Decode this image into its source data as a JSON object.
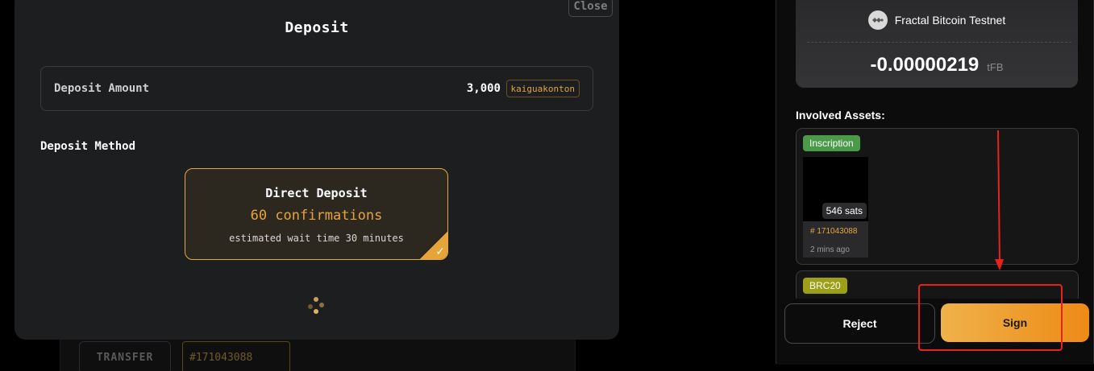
{
  "background": {
    "transfer_label": "TRANSFER",
    "inscription_label": "#171043088"
  },
  "modal": {
    "close_label": "Close",
    "title": "Deposit",
    "amount_label": "Deposit Amount",
    "amount_value": "3,000",
    "ticker": "kaiguakonton",
    "method_label": "Deposit Method",
    "method": {
      "title": "Direct Deposit",
      "confirmations": "60 confirmations",
      "wait": "estimated wait time 30 minutes",
      "selected": true
    }
  },
  "wallet": {
    "network_name": "Fractal Bitcoin Testnet",
    "network_icon": "fractal-logo-icon",
    "balance_change": "-0.00000219",
    "unit": "tFB",
    "involved_label": "Involved Assets:",
    "assets": [
      {
        "tag": "Inscription",
        "tag_color": "#4a9a4a",
        "sats": "546 sats",
        "number": "# 171043088",
        "time": "2 mins ago"
      },
      {
        "tag": "BRC20",
        "tag_color": "#9ba016"
      }
    ],
    "reject_label": "Reject",
    "sign_label": "Sign"
  },
  "colors": {
    "accent": "#e7a43a",
    "annotation": "#e8221b"
  }
}
